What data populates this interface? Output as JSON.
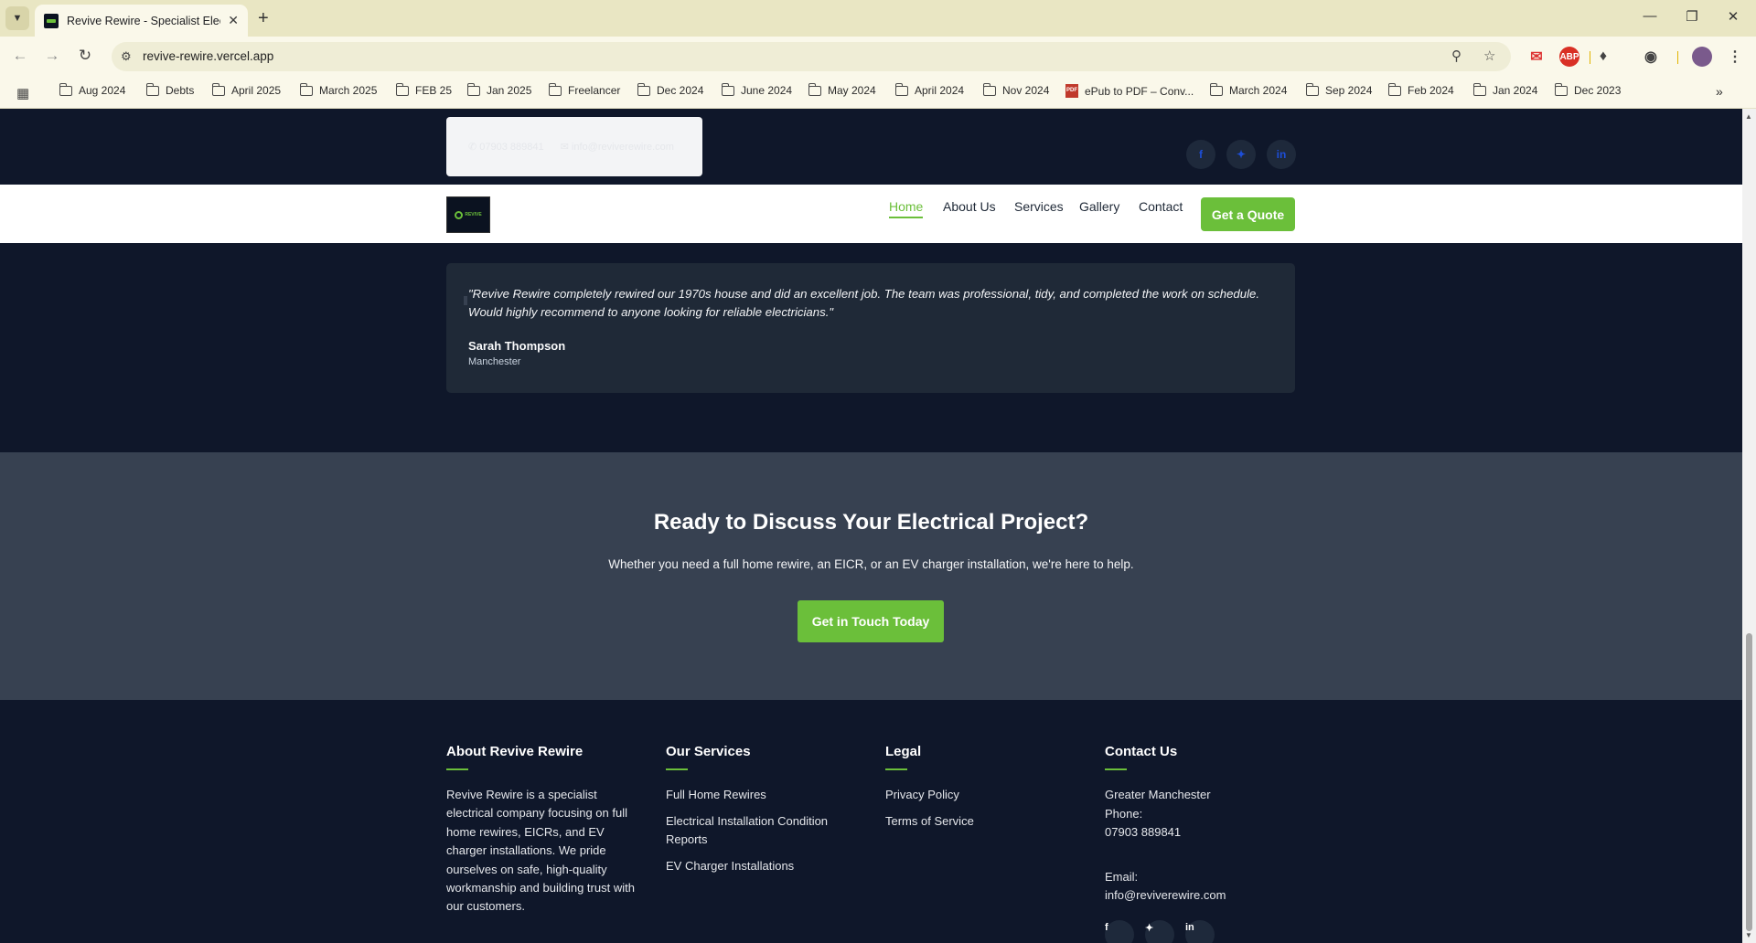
{
  "browser": {
    "tab_title": "Revive Rewire - Specialist Electri",
    "url": "revive-rewire.vercel.app",
    "bookmarks": [
      "Aug 2024",
      "Debts",
      "April 2025",
      "March 2025",
      "FEB 25",
      "Jan 2025",
      "Freelancer",
      "Dec 2024",
      "June 2024",
      "May 2024",
      "April 2024",
      "Nov 2024",
      "ePub to PDF – Conv...",
      "March 2024",
      "Sep 2024",
      "Feb 2024",
      "Jan 2024",
      "Dec 2023"
    ]
  },
  "topbar": {
    "phone": "07903 889841",
    "email": "info@reviverewire.com"
  },
  "nav": {
    "links": [
      "Home",
      "About Us",
      "Services",
      "Gallery",
      "Contact"
    ],
    "active": "Home",
    "cta": "Get a Quote"
  },
  "testimonial": {
    "quote": "\"Revive Rewire completely rewired our 1970s house and did an excellent job. The team was professional, tidy, and completed the work on schedule. Would highly recommend to anyone looking for reliable electricians.\"",
    "author": "Sarah Thompson",
    "location": "Manchester"
  },
  "cta": {
    "title": "Ready to Discuss Your Electrical Project?",
    "subtitle": "Whether you need a full home rewire, an EICR, or an EV charger installation, we're here to help.",
    "button": "Get in Touch Today"
  },
  "footer": {
    "about": {
      "heading": "About Revive Rewire",
      "text": "Revive Rewire is a specialist electrical company focusing on full home rewires, EICRs, and EV charger installations. We pride ourselves on safe, high-quality workmanship and building trust with our customers."
    },
    "services": {
      "heading": "Our Services",
      "items": [
        "Full Home Rewires",
        "Electrical Installation Condition Reports",
        "EV Charger Installations"
      ]
    },
    "legal": {
      "heading": "Legal",
      "items": [
        "Privacy Policy",
        "Terms of Service"
      ]
    },
    "contact": {
      "heading": "Contact Us",
      "area": "Greater Manchester",
      "phone_label": "Phone:",
      "phone": "07903 889841",
      "email_label": "Email:",
      "email": "info@reviverewire.com"
    }
  },
  "colors": {
    "accent": "#6bbf3a",
    "dark": "#0f172a",
    "cta_bg": "#374151"
  }
}
